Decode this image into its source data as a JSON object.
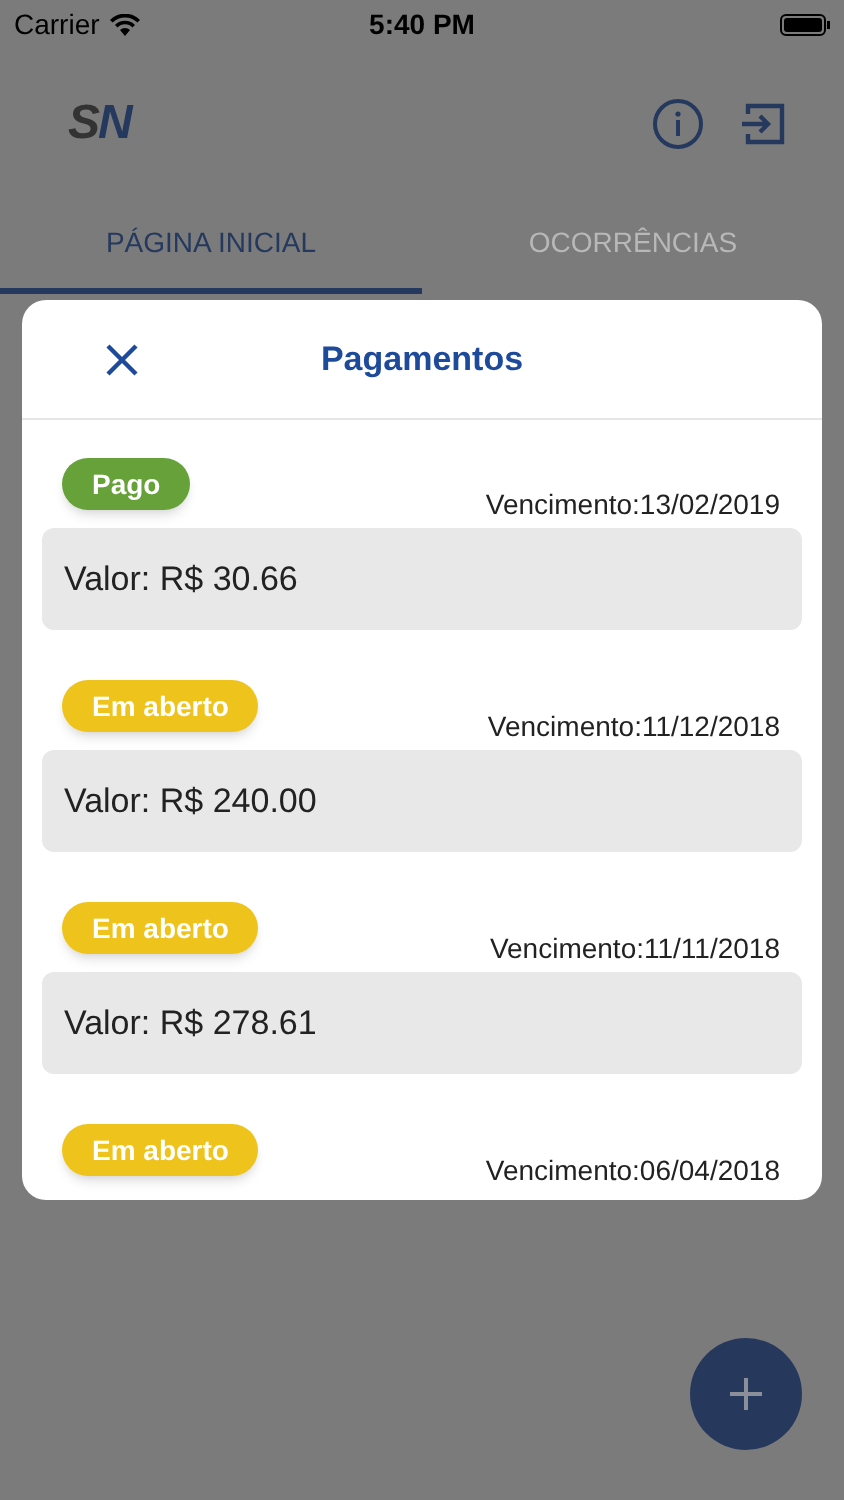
{
  "status_bar": {
    "carrier": "Carrier",
    "time": "5:40 PM"
  },
  "header": {
    "logo": "SN"
  },
  "tabs": [
    {
      "label": "PÁGINA INICIAL",
      "selected": true
    },
    {
      "label": "OCORRÊNCIAS",
      "selected": false
    }
  ],
  "dialog": {
    "title": "Pagamentos",
    "payments": [
      {
        "color": "#67a13a",
        "badge": "Pago",
        "due": "Vencimento:13/02/2019",
        "value": "Valor: R$ 30.66"
      },
      {
        "color": "#eec31b",
        "badge": "Em aberto",
        "due": "Vencimento:11/12/2018",
        "value": "Valor: R$ 240.00"
      },
      {
        "color": "#eec31b",
        "badge": "Em aberto",
        "due": "Vencimento:11/11/2018",
        "value": "Valor: R$ 278.61"
      },
      {
        "color": "#eec31b",
        "badge": "Em aberto",
        "due": "Vencimento:06/04/2018"
      }
    ]
  }
}
